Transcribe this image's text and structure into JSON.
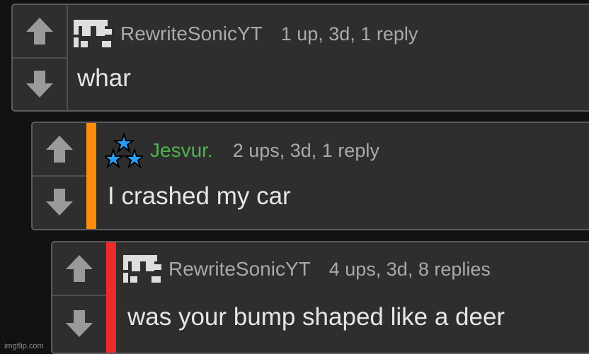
{
  "comments": [
    {
      "username": "RewriteSonicYT",
      "username_color": "#a9a9a9",
      "avatar": "pixel-avatar-icon",
      "stats": "1 up, 3d, 1 reply",
      "text": "whar",
      "stripe_color": null
    },
    {
      "username": "Jesvur.",
      "username_color": "#4db34a",
      "avatar": "stars-avatar-icon",
      "stats": "2 ups, 3d, 1 reply",
      "text": "I crashed my car",
      "stripe_color": "#ff8c0a"
    },
    {
      "username": "RewriteSonicYT",
      "username_color": "#a9a9a9",
      "avatar": "pixel-avatar-icon",
      "stats": "4 ups, 3d, 8 replies",
      "text": "was your bump shaped like a deer",
      "stripe_color": "#ee2a2a"
    }
  ],
  "watermark": "imgflip.com"
}
